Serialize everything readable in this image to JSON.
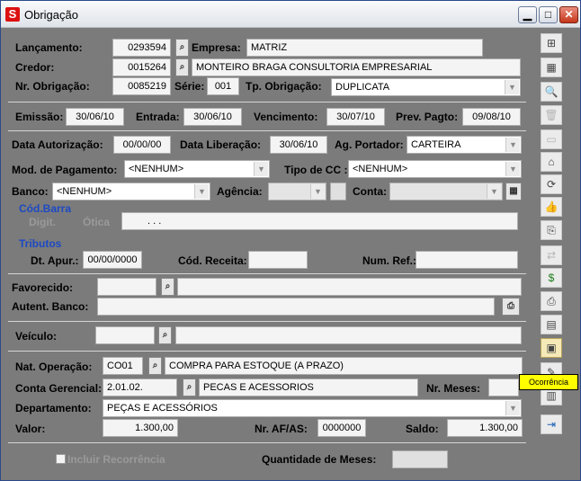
{
  "window": {
    "title": "Obrigação",
    "app_icon": "S",
    "minimize": "▁",
    "maximize": "□",
    "close": "✕"
  },
  "form": {
    "lancamento": {
      "label": "Lançamento:",
      "value": "0293594"
    },
    "empresa": {
      "label": "Empresa:",
      "value": "MATRIZ"
    },
    "credor": {
      "label": "Credor:",
      "code": "0015264",
      "name": "MONTEIRO BRAGA CONSULTORIA EMPRESARIAL"
    },
    "nr_obrigacao": {
      "label": "Nr. Obrigação:",
      "value": "0085219"
    },
    "serie": {
      "label": "Série:",
      "value": "001"
    },
    "tp_obrigacao": {
      "label": "Tp. Obrigação:",
      "value": "DUPLICATA"
    },
    "emissao": {
      "label": "Emissão:",
      "value": "30/06/10"
    },
    "entrada": {
      "label": "Entrada:",
      "value": "30/06/10"
    },
    "vencimento": {
      "label": "Vencimento:",
      "value": "30/07/10"
    },
    "prev_pagto": {
      "label": "Prev. Pagto:",
      "value": "09/08/10"
    },
    "data_autorizacao": {
      "label": "Data Autorização:",
      "value": "00/00/00"
    },
    "data_liberacao": {
      "label": "Data Liberação:",
      "value": "30/06/10"
    },
    "ag_portador": {
      "label": "Ag. Portador:",
      "value": "CARTEIRA"
    },
    "mod_pagamento": {
      "label": "Mod. de Pagamento:",
      "value": "<NENHUM>"
    },
    "tipo_cc": {
      "label": "Tipo de CC :",
      "value": "<NENHUM>"
    },
    "banco": {
      "label": "Banco:",
      "value": "<NENHUM>"
    },
    "agencia": {
      "label": "Agência:",
      "value": ""
    },
    "conta": {
      "label": "Conta:",
      "value": ""
    },
    "cod_barra": {
      "label": "Cód.Barra",
      "digit": "Digit.",
      "otica": "Ótica",
      "value": ".          .          ."
    },
    "tributos": {
      "label": "Tributos"
    },
    "dt_apur": {
      "label": "Dt. Apur.:",
      "value": "00/00/0000"
    },
    "cod_receita": {
      "label": "Cód. Receita:",
      "value": ""
    },
    "num_ref": {
      "label": "Num. Ref.:",
      "value": ""
    },
    "favorecido": {
      "label": "Favorecido:",
      "code": "",
      "name": ""
    },
    "autent_banco": {
      "label": "Autent. Banco:",
      "value": ""
    },
    "veiculo": {
      "label": "Veículo:",
      "code": "",
      "name": ""
    },
    "nat_operacao": {
      "label": "Nat. Operação:",
      "code": "CO01",
      "name": "COMPRA PARA ESTOQUE (A PRAZO)"
    },
    "conta_gerencial": {
      "label": "Conta Gerencial:",
      "code": "2.01.02.",
      "name": "PECAS E ACESSORIOS"
    },
    "nr_meses": {
      "label": "Nr. Meses:",
      "value": ""
    },
    "departamento": {
      "label": "Departamento:",
      "value": "PEÇAS E ACESSÓRIOS"
    },
    "valor": {
      "label": "Valor:",
      "value": "1.300,00"
    },
    "nr_af_as": {
      "label": "Nr. AF/AS:",
      "value": "0000000"
    },
    "saldo": {
      "label": "Saldo:",
      "value": "1.300,00"
    },
    "incluir_recorrencia": {
      "label": "Incluir Recorrência"
    },
    "quantidade_meses": {
      "label": "Quantidade de Meses:",
      "value": ""
    }
  },
  "toolbar": {
    "tooltip": "Ocorrência",
    "buttons": [
      {
        "name": "tree-icon",
        "glyph": "⊞"
      },
      {
        "name": "spreadsheet-icon",
        "glyph": "▦"
      },
      {
        "name": "preview-icon",
        "glyph": "🔍"
      },
      {
        "name": "trash-icon",
        "glyph": "🗑"
      },
      {
        "name": "folder-icon",
        "glyph": "▭"
      },
      {
        "name": "stamp-icon",
        "glyph": "⌂"
      },
      {
        "name": "cycle-icon",
        "glyph": "⟳"
      },
      {
        "name": "thumbs-up-icon",
        "glyph": "👍"
      },
      {
        "name": "copy-icon",
        "glyph": "⎘"
      },
      {
        "name": "switch-icon",
        "glyph": "⇄"
      },
      {
        "name": "money-bag-icon",
        "glyph": "$"
      },
      {
        "name": "printer-icon",
        "glyph": "⎙"
      },
      {
        "name": "report-icon",
        "glyph": "▤"
      },
      {
        "name": "occurrence-icon",
        "glyph": "▣"
      },
      {
        "name": "tools-icon",
        "glyph": "✎"
      },
      {
        "name": "document-icon",
        "glyph": "▥"
      },
      {
        "name": "exit-icon",
        "glyph": "⇥"
      }
    ]
  }
}
